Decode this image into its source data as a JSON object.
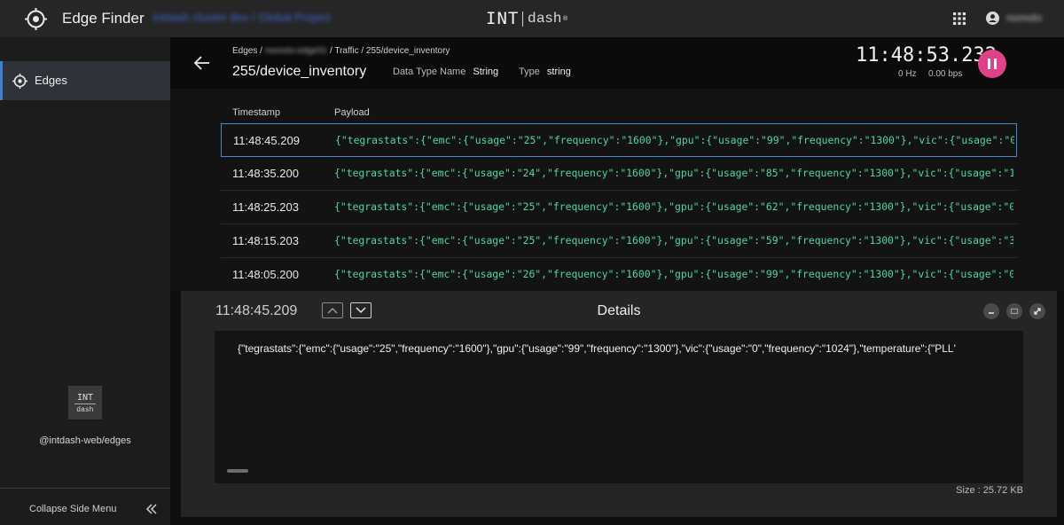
{
  "topbar": {
    "app_title": "Edge Finder",
    "project_name": "intdash cluster dev / Global Project",
    "brand_int": "INT",
    "brand_dash": "dash",
    "brand_mark": "®",
    "user_name": "nomoto"
  },
  "sidebar": {
    "items": [
      {
        "label": "Edges",
        "icon": "crosshair-icon"
      }
    ],
    "package": "@intdash-web/edges",
    "logo_int": "INT",
    "logo_dash": "dash",
    "collapse_label": "Collapse Side Menu"
  },
  "header": {
    "breadcrumb": [
      "Edges /",
      "nomoto-edge01",
      "/ Traffic / 255/device_inventory"
    ],
    "title": "255/device_inventory",
    "data_type_name_label": "Data Type Name",
    "data_type_name_value": "String",
    "type_label": "Type",
    "type_value": "string",
    "clock": "11:48:53.232",
    "rate_hz": "0 Hz",
    "rate_bps": "0.00 bps"
  },
  "table": {
    "columns": [
      "Timestamp",
      "Payload"
    ],
    "rows": [
      {
        "ts": "11:48:45.209",
        "payload": "{\"tegrastats\":{\"emc\":{\"usage\":\"25\",\"frequency\":\"1600\"},\"gpu\":{\"usage\":\"99\",\"frequency\":\"1300\"},\"vic\":{\"usage\":\"0\""
      },
      {
        "ts": "11:48:35.200",
        "payload": "{\"tegrastats\":{\"emc\":{\"usage\":\"24\",\"frequency\":\"1600\"},\"gpu\":{\"usage\":\"85\",\"frequency\":\"1300\"},\"vic\":{\"usage\":\"1\""
      },
      {
        "ts": "11:48:25.203",
        "payload": "{\"tegrastats\":{\"emc\":{\"usage\":\"25\",\"frequency\":\"1600\"},\"gpu\":{\"usage\":\"62\",\"frequency\":\"1300\"},\"vic\":{\"usage\":\"0\""
      },
      {
        "ts": "11:48:15.203",
        "payload": "{\"tegrastats\":{\"emc\":{\"usage\":\"25\",\"frequency\":\"1600\"},\"gpu\":{\"usage\":\"59\",\"frequency\":\"1300\"},\"vic\":{\"usage\":\"3\""
      },
      {
        "ts": "11:48:05.200",
        "payload": "{\"tegrastats\":{\"emc\":{\"usage\":\"26\",\"frequency\":\"1600\"},\"gpu\":{\"usage\":\"99\",\"frequency\":\"1300\"},\"vic\":{\"usage\":\"0\""
      }
    ]
  },
  "details": {
    "timestamp": "11:48:45.209",
    "title": "Details",
    "content": "{\"tegrastats\":{\"emc\":{\"usage\":\"25\",\"frequency\":\"1600\"},\"gpu\":{\"usage\":\"99\",\"frequency\":\"1300\"},\"vic\":{\"usage\":\"0\",\"frequency\":\"1024\"},\"temperature\":{\"PLL'",
    "size": "Size : 25.72 KB"
  },
  "colors": {
    "accent": "#3f7fd0",
    "payload": "#4fd6a6",
    "pause": "#e0428a"
  }
}
